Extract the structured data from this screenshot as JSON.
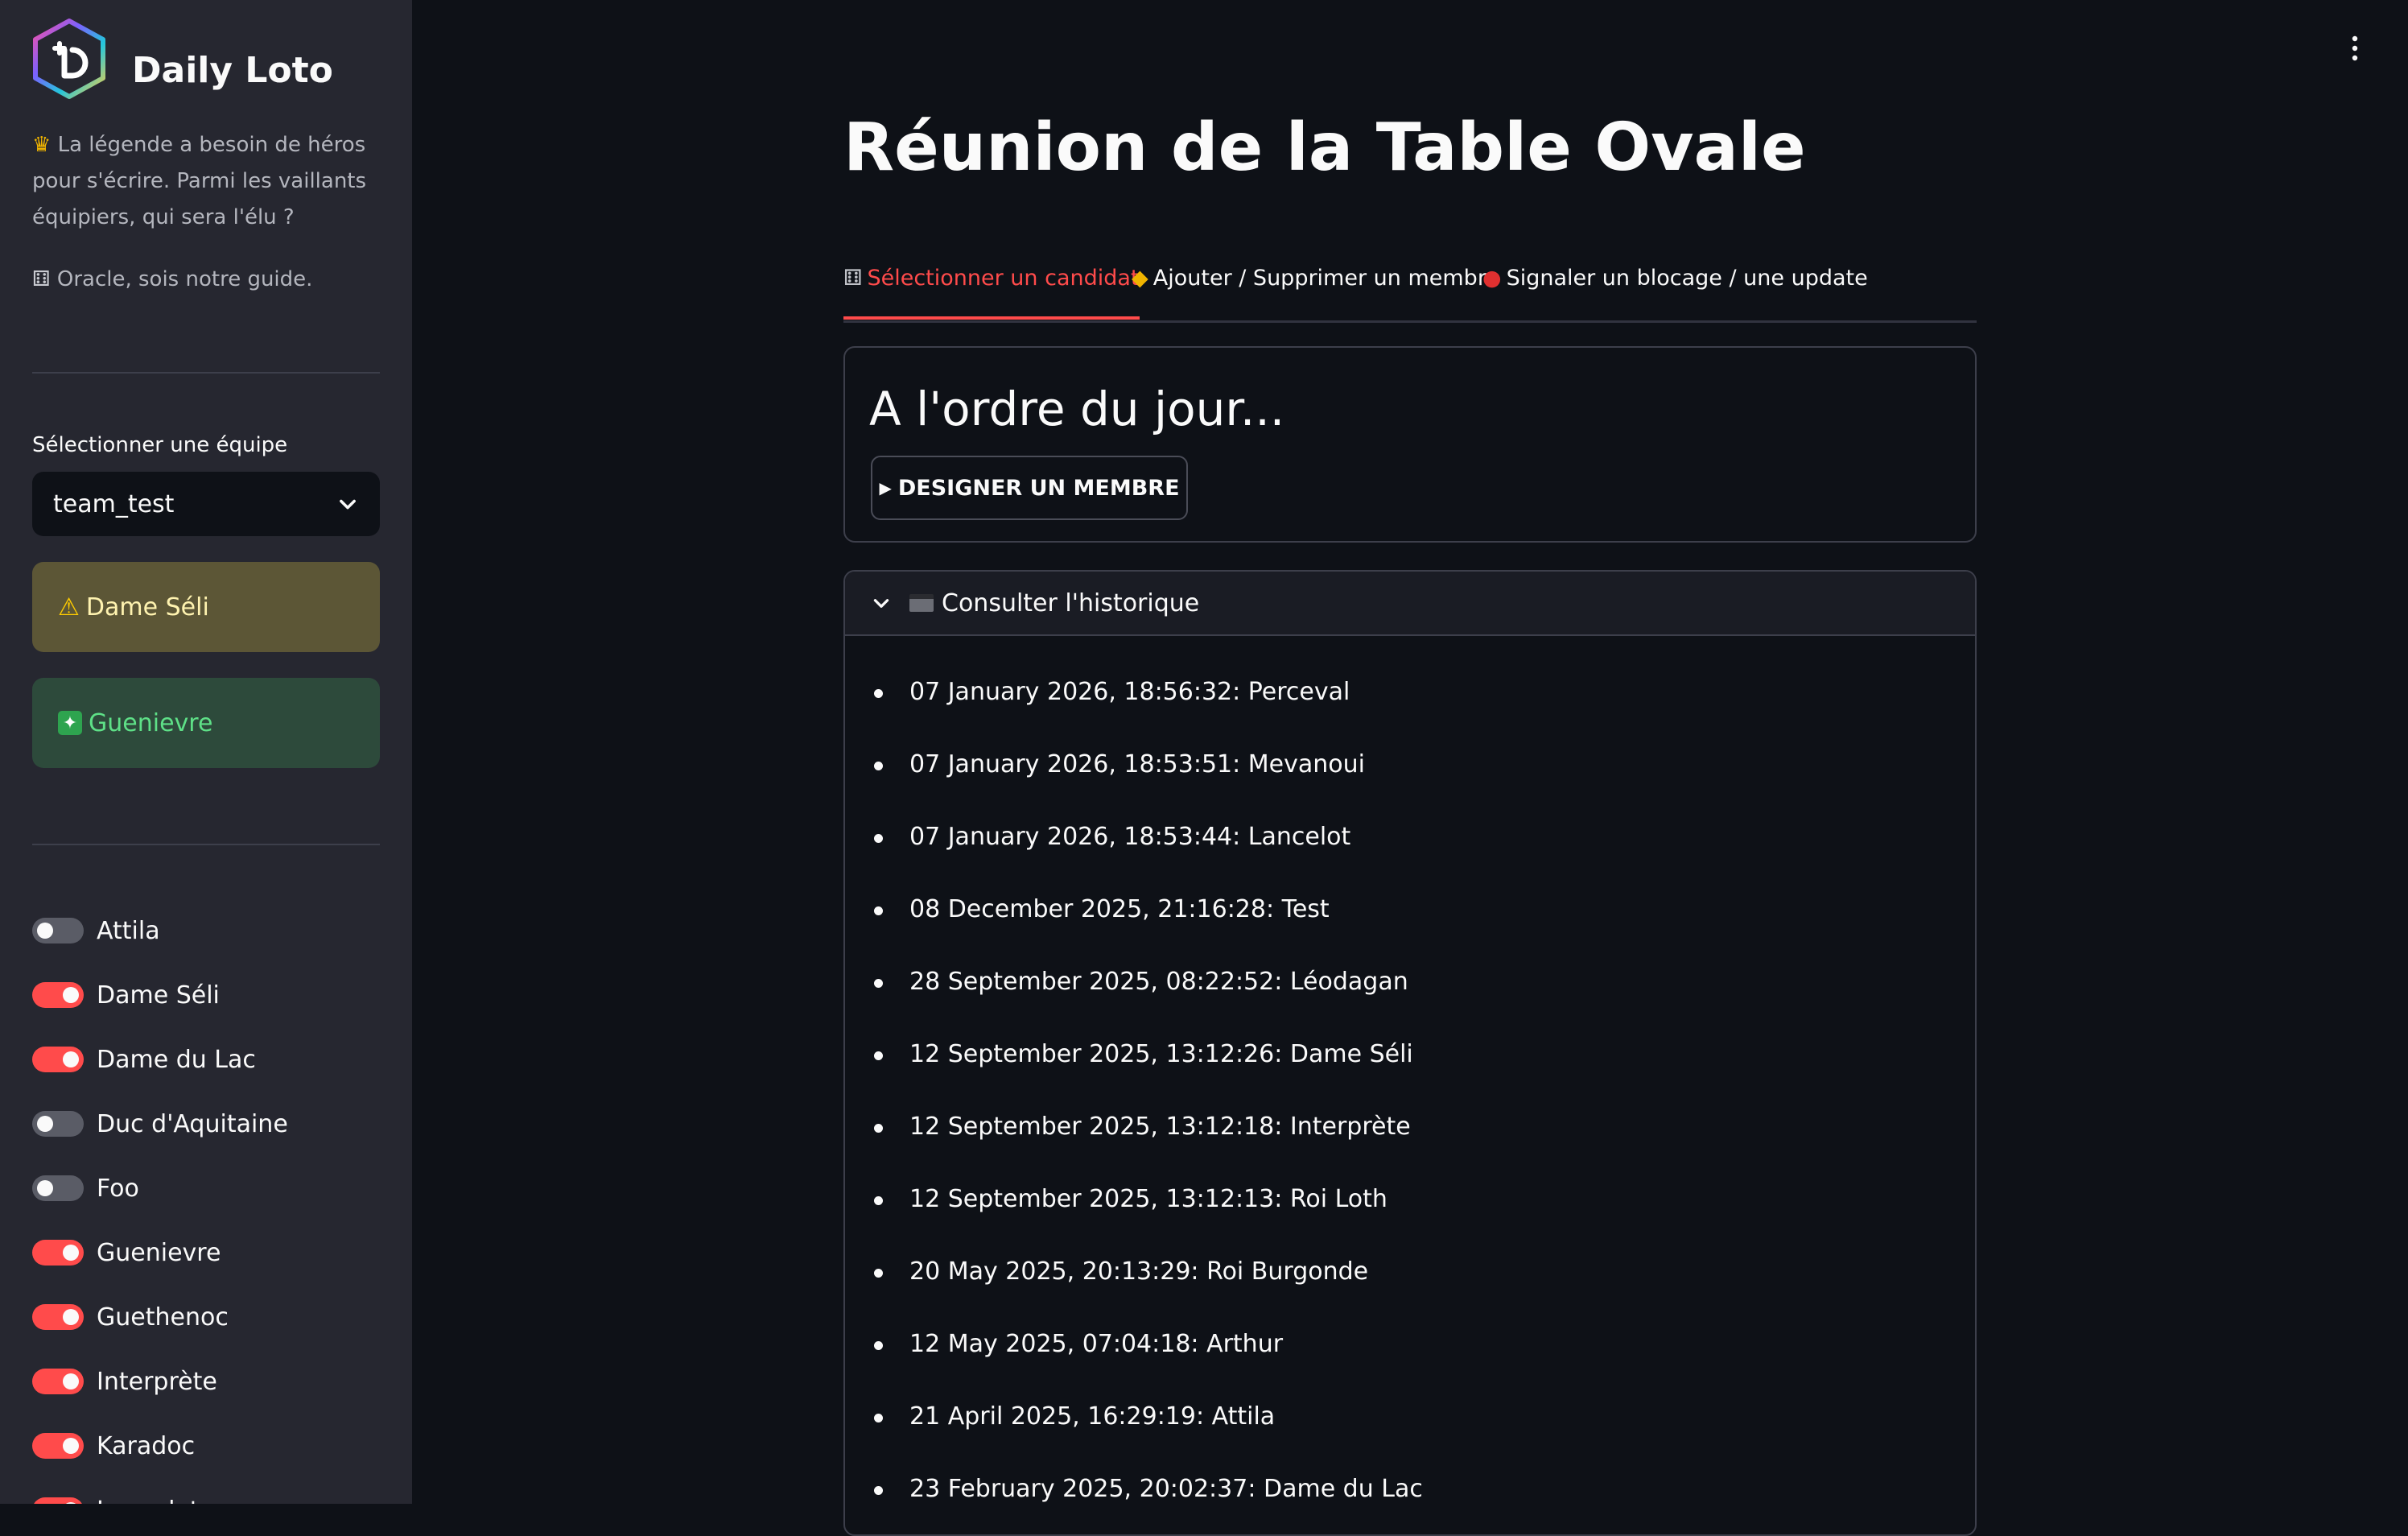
{
  "app": {
    "title": "Daily Loto"
  },
  "sidebar": {
    "intro_line1": "La légende a besoin de héros pour s'écrire. Parmi les vaillants équipiers, qui sera l'élu ?",
    "intro_line2": "Oracle, sois notre guide.",
    "team_select": {
      "label": "Sélectionner une équipe",
      "value": "team_test"
    },
    "warning_alert": "Dame Séli",
    "success_alert": "Guenievre",
    "members": [
      {
        "name": "Attila",
        "enabled": false
      },
      {
        "name": "Dame Séli",
        "enabled": true
      },
      {
        "name": "Dame du Lac",
        "enabled": true
      },
      {
        "name": "Duc d'Aquitaine",
        "enabled": false
      },
      {
        "name": "Foo",
        "enabled": false
      },
      {
        "name": "Guenievre",
        "enabled": true
      },
      {
        "name": "Guethenoc",
        "enabled": true
      },
      {
        "name": "Interprète",
        "enabled": true
      },
      {
        "name": "Karadoc",
        "enabled": true
      },
      {
        "name": "Lancelot",
        "enabled": true
      }
    ]
  },
  "main": {
    "title": "Réunion de la Table Ovale",
    "tabs": [
      {
        "label": "Sélectionner un candidat",
        "icon": "dice-icon",
        "active": true
      },
      {
        "label": "Ajouter / Supprimer un membre",
        "icon": "sign-icon",
        "active": false
      },
      {
        "label": "Signaler un blocage / une update",
        "icon": "red-circle-icon",
        "active": false
      }
    ],
    "card_heading": "A l'ordre du jour...",
    "designate_button": "DESIGNER UN MEMBRE",
    "history": {
      "title": "Consulter l'historique",
      "entries": [
        "07 January 2026, 18:56:32: Perceval",
        "07 January 2026, 18:53:51: Mevanoui",
        "07 January 2026, 18:53:44: Lancelot",
        "08 December 2025, 21:16:28: Test",
        "28 September 2025, 08:22:52: Léodagan",
        "12 September 2025, 13:12:26: Dame Séli",
        "12 September 2025, 13:12:18: Interprète",
        "12 September 2025, 13:12:13: Roi Loth",
        "20 May 2025, 20:13:29: Roi Burgonde",
        "12 May 2025, 07:04:18: Arthur",
        "21 April 2025, 16:29:19: Attila",
        "23 February 2025, 20:02:37: Dame du Lac"
      ]
    }
  },
  "colors": {
    "accent": "#ff4b4b",
    "background": "#0e1117",
    "sidebar": "#262730",
    "warning_bg": "#5c5636",
    "success_bg": "#2d4a3b",
    "success_text": "#5ee087"
  }
}
